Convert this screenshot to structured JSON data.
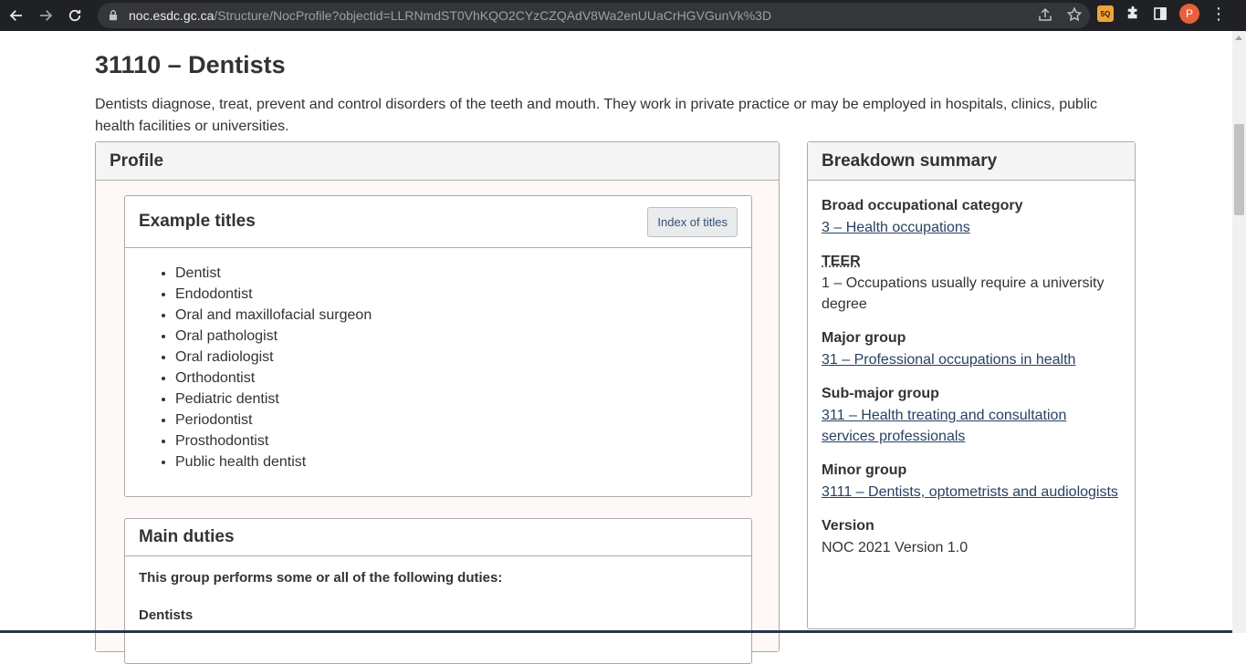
{
  "browser": {
    "url_host": "noc.esdc.gc.ca",
    "url_path": "/Structure/NocProfile?objectid=LLRNmdST0VhKQO2CYzCZQAdV8Wa2enUUaCrHGVGunVk%3D",
    "profile_initial": "P",
    "ext_badge_text": "5Q"
  },
  "page": {
    "title": "31110 – Dentists",
    "lead": "Dentists diagnose, treat, prevent and control disorders of the teeth and mouth. They work in private practice or may be employed in hospitals, clinics, public health facilities or universities."
  },
  "profile": {
    "heading": "Profile",
    "example_titles": {
      "heading": "Example titles",
      "button": "Index of titles",
      "items": [
        "Dentist",
        "Endodontist",
        "Oral and maxillofacial surgeon",
        "Oral pathologist",
        "Oral radiologist",
        "Orthodontist",
        "Pediatric dentist",
        "Periodontist",
        "Prosthodontist",
        "Public health dentist"
      ]
    },
    "main_duties": {
      "heading": "Main duties",
      "intro": "This group performs some or all of the following duties:",
      "subheading": "Dentists"
    }
  },
  "breakdown": {
    "heading": "Breakdown summary",
    "items": [
      {
        "label": "Broad occupational category",
        "value": "3 – Health occupations",
        "link": true
      },
      {
        "label": "TEER",
        "value": "1 – Occupations usually require a university degree",
        "link": false
      },
      {
        "label": "Major group",
        "value": "31 – Professional occupations in health",
        "link": true
      },
      {
        "label": "Sub-major group",
        "value": "311 – Health treating and consultation services professionals",
        "link": true
      },
      {
        "label": "Minor group",
        "value": "3111 – Dentists, optometrists and audiologists",
        "link": true
      },
      {
        "label": "Version",
        "value": "NOC 2021 Version 1.0",
        "link": false
      }
    ]
  }
}
